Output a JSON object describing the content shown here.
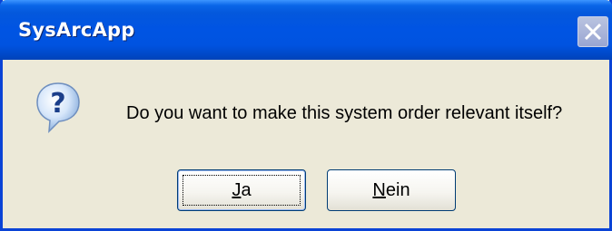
{
  "window": {
    "title": "SysArcApp"
  },
  "dialog": {
    "icon": "question-icon",
    "message": "Do you want to make this system order relevant itself?"
  },
  "buttons": {
    "yes": {
      "mnemonic": "J",
      "rest": "a"
    },
    "no": {
      "mnemonic": "N",
      "rest": "ein"
    }
  },
  "colors": {
    "titlebar": "#0054E3",
    "background": "#ECE9D8",
    "button_border": "#003C74"
  }
}
